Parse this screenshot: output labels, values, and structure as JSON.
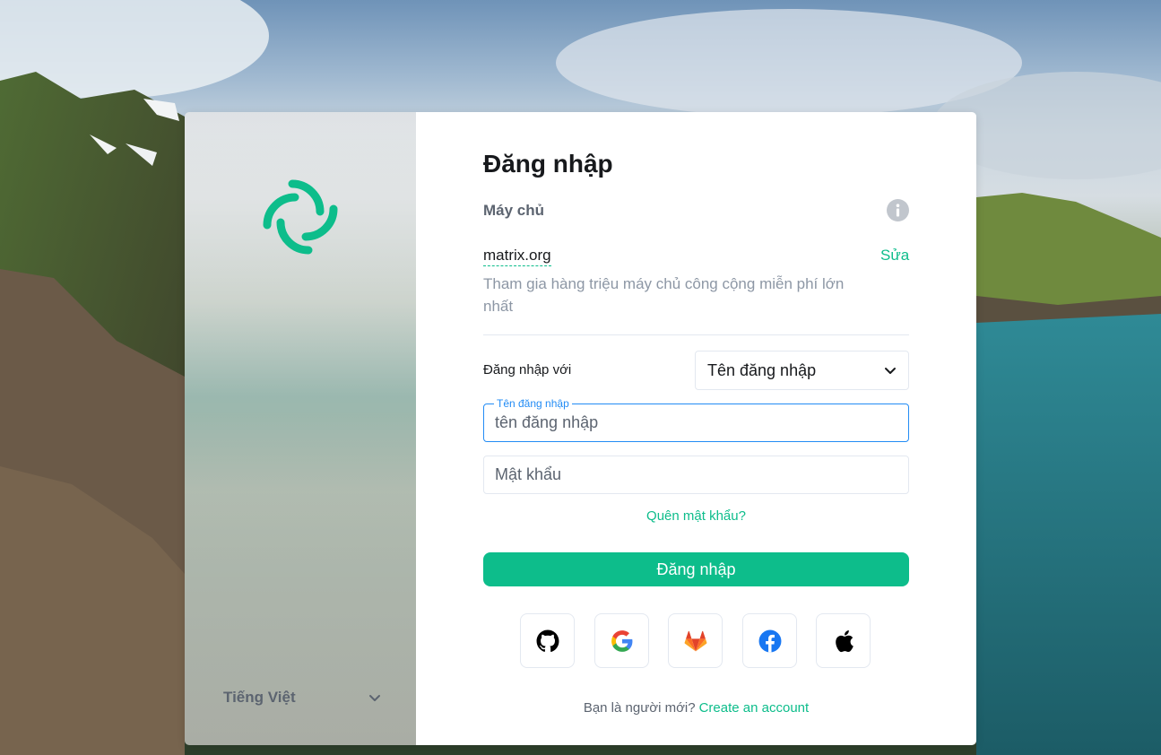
{
  "page": {
    "title": "Đăng nhập"
  },
  "server": {
    "label": "Máy chủ",
    "name": "matrix.org",
    "edit_label": "Sửa",
    "description": "Tham gia hàng triệu máy chủ công cộng miễn phí lớn nhất"
  },
  "login_with": {
    "label": "Đăng nhập với",
    "selected": "Tên đăng nhập"
  },
  "username": {
    "legend": "Tên đăng nhập",
    "value": "",
    "placeholder": "tên đăng nhập"
  },
  "password": {
    "value": "",
    "placeholder": "Mật khẩu"
  },
  "forgot_password": "Quên mật khẩu?",
  "submit_label": "Đăng nhập",
  "sso_providers": [
    "github-icon",
    "google-icon",
    "gitlab-icon",
    "facebook-icon",
    "apple-icon"
  ],
  "signup": {
    "prompt": "Bạn là người mới?",
    "link": "Create an account"
  },
  "language": {
    "selected": "Tiếng Việt"
  },
  "colors": {
    "accent": "#0dbd8b",
    "focus": "#238cf5",
    "text_primary": "#17191c",
    "text_secondary": "#5c6470",
    "text_muted": "#8d97a5"
  }
}
